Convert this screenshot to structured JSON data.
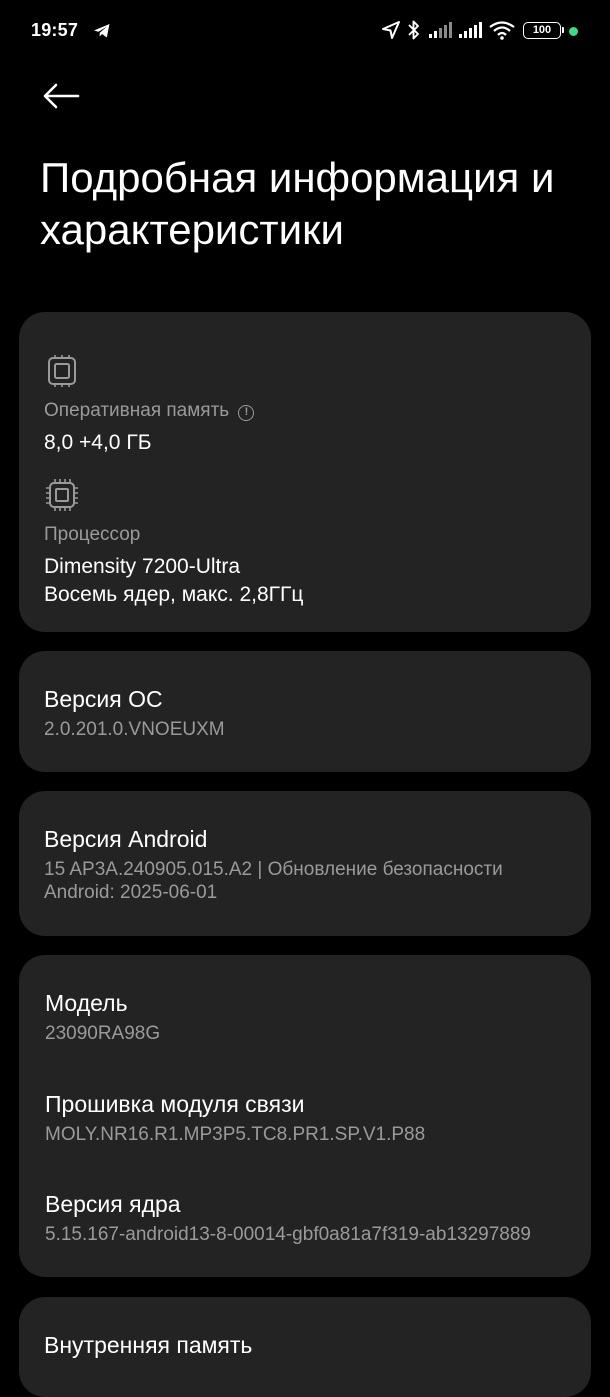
{
  "status_bar": {
    "time": "19:57",
    "left_icons": [
      "telegram-icon"
    ],
    "right_icons": [
      "location-arrow-icon",
      "bluetooth-icon",
      "signal-icon",
      "signal-icon",
      "wifi-icon"
    ],
    "battery": "100",
    "indicator_color": "#3ddc84"
  },
  "header": {
    "back_icon": "arrow-left-icon",
    "title": "Подробная информация и характеристики"
  },
  "hardware": {
    "ram": {
      "icon": "chip-icon",
      "label": "Оперативная память",
      "info_icon": "info-icon",
      "value": "8,0 +4,0 ГБ"
    },
    "cpu": {
      "icon": "processor-icon",
      "label": "Процессор",
      "value_line1": "Dimensity 7200-Ultra",
      "value_line2": "Восемь ядер, макс. 2,8ГГц"
    }
  },
  "os_version": {
    "title": "Версия ОС",
    "value": "2.0.201.0.VNOEUXM"
  },
  "android_version": {
    "title": "Версия Android",
    "value_line1": "15 AP3A.240905.015.A2 | Обновление безопасности",
    "value_line2": "Android: 2025-06-01"
  },
  "device_info": {
    "model": {
      "title": "Модель",
      "value": "23090RA98G"
    },
    "baseband": {
      "title": "Прошивка модуля связи",
      "value": "MOLY.NR16.R1.MP3P5.TC8.PR1.SP.V1.P88"
    },
    "kernel": {
      "title": "Версия ядра",
      "value": "5.15.167-android13-8-00014-gbf0a81a7f319-ab13297889"
    }
  },
  "storage": {
    "title": "Внутренняя память"
  },
  "colors": {
    "background": "#000000",
    "card": "#232323",
    "secondary_text": "#9a9a9a"
  }
}
